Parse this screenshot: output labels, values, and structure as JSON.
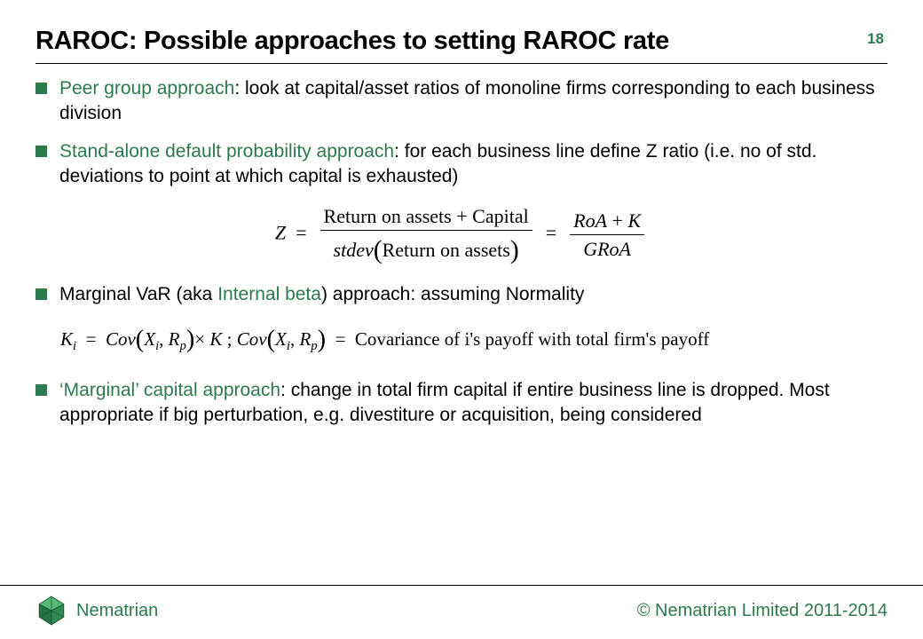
{
  "slide": {
    "title": "RAROC:  Possible approaches to setting RAROC  rate",
    "page_number": "18",
    "bullets": [
      {
        "lead": "Peer group approach",
        "rest": ": look at capital/asset ratios of monoline firms corresponding to each business division"
      },
      {
        "lead": "Stand-alone default probability approach",
        "rest": ": for each business line define Z ratio (i.e. no of std. deviations to point at which capital is exhausted)"
      },
      {
        "pre": "Marginal VaR (aka ",
        "lead": "Internal beta",
        "rest": ") approach: assuming Normality"
      },
      {
        "lead": "‘Marginal’ capital approach",
        "rest": ": change in total firm capital if entire business line is dropped. Most appropriate if big perturbation, e.g. divestiture or acquisition, being considered"
      }
    ],
    "formula1_plain": "Z = (Return on assets + Capital) / stdev(Return on assets) = (RoA + K) / GRoA",
    "formula2_plain": "K_i = Cov(X_i, R_p) × K ;  Cov(X_i, R_p) = Covariance of i's payoff with total firm's payoff",
    "f1": {
      "Z": "Z",
      "eq": "=",
      "num1a": "Return on assets",
      "plus": "+",
      "num1b": "Capital",
      "den1a": "stdev",
      "lp": "(",
      "den1b": "Return on assets",
      "rp": ")",
      "num2a": "RoA",
      "num2b": "K",
      "den2": "GRoA"
    },
    "f2": {
      "K": "K",
      "i": "i",
      "eq": "=",
      "Cov": "Cov",
      "lp": "(",
      "X": "X",
      "comma": ",",
      "R": "R",
      "p": "p",
      "rp": ")",
      "times": "×",
      "K2": "K",
      "sep": " ;   ",
      "tail": "Covariance of i's payoff with total firm's payoff"
    },
    "footer": {
      "brand": "Nematrian",
      "copyright": "© Nematrian Limited 2011-2014"
    }
  }
}
